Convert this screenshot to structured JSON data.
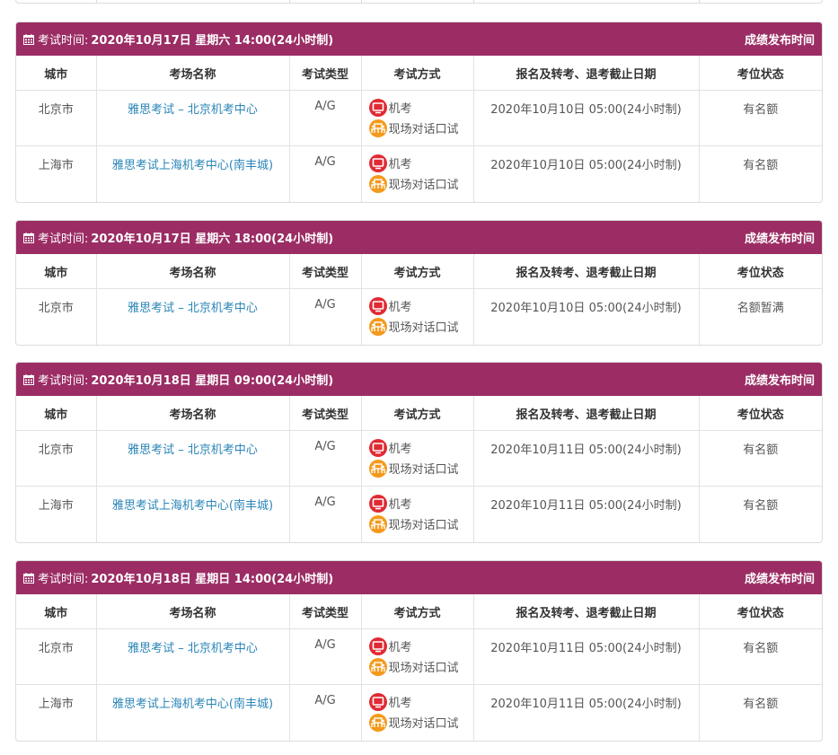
{
  "colors": {
    "header_bg": "#9b2d64",
    "link": "#2a85b7",
    "computer_icon": "#e02a34",
    "speaking_icon": "#f39a1c"
  },
  "icons": {
    "calendar": "calendar-icon",
    "computer": "computer-icon",
    "speaking": "face-to-face-icon"
  },
  "columns": [
    "城市",
    "考场名称",
    "考试类型",
    "考试方式",
    "报名及转考、退考截止日期",
    "考位状态"
  ],
  "header_prefix": "考试时间:",
  "result_link": "成绩发布时间",
  "sessions": [
    {
      "time": "2020年10月17日 星期六 14:00(24小时制)",
      "rows": [
        {
          "city": "北京市",
          "venue": "雅思考试 – 北京机考中心",
          "type": "A/G",
          "method1": "机考",
          "method2": "现场对话口试",
          "deadline": "2020年10月10日 05:00(24小时制)",
          "status": "有名额"
        },
        {
          "city": "上海市",
          "venue": "雅思考试上海机考中心(南丰城)",
          "type": "A/G",
          "method1": "机考",
          "method2": "现场对话口试",
          "deadline": "2020年10月10日 05:00(24小时制)",
          "status": "有名额"
        }
      ]
    },
    {
      "time": "2020年10月17日 星期六 18:00(24小时制)",
      "rows": [
        {
          "city": "北京市",
          "venue": "雅思考试 – 北京机考中心",
          "type": "A/G",
          "method1": "机考",
          "method2": "现场对话口试",
          "deadline": "2020年10月10日 05:00(24小时制)",
          "status": "名额暂满"
        }
      ]
    },
    {
      "time": "2020年10月18日 星期日 09:00(24小时制)",
      "rows": [
        {
          "city": "北京市",
          "venue": "雅思考试 – 北京机考中心",
          "type": "A/G",
          "method1": "机考",
          "method2": "现场对话口试",
          "deadline": "2020年10月11日 05:00(24小时制)",
          "status": "有名额"
        },
        {
          "city": "上海市",
          "venue": "雅思考试上海机考中心(南丰城)",
          "type": "A/G",
          "method1": "机考",
          "method2": "现场对话口试",
          "deadline": "2020年10月11日 05:00(24小时制)",
          "status": "有名额"
        }
      ]
    },
    {
      "time": "2020年10月18日 星期日 14:00(24小时制)",
      "rows": [
        {
          "city": "北京市",
          "venue": "雅思考试 – 北京机考中心",
          "type": "A/G",
          "method1": "机考",
          "method2": "现场对话口试",
          "deadline": "2020年10月11日 05:00(24小时制)",
          "status": "有名额"
        },
        {
          "city": "上海市",
          "venue": "雅思考试上海机考中心(南丰城)",
          "type": "A/G",
          "method1": "机考",
          "method2": "现场对话口试",
          "deadline": "2020年10月11日 05:00(24小时制)",
          "status": "有名额"
        }
      ]
    }
  ]
}
